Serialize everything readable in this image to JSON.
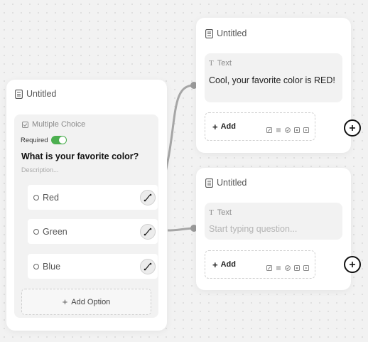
{
  "question_card": {
    "title": "Untitled",
    "block_type": "Multiple Choice",
    "required_label": "Required",
    "question": "What is your favorite color?",
    "description_placeholder": "Description...",
    "options": [
      {
        "label": "Red"
      },
      {
        "label": "Green"
      },
      {
        "label": "Blue"
      }
    ],
    "add_option_label": "Add Option"
  },
  "text_card_1": {
    "title": "Untitled",
    "block_type": "Text",
    "text": "Cool, your favorite color is RED!",
    "add_label": "Add"
  },
  "text_card_2": {
    "title": "Untitled",
    "block_type": "Text",
    "placeholder": "Start typing question...",
    "add_label": "Add"
  },
  "colors": {
    "toggle_on": "#4caf50",
    "connector": "#a6a6a6"
  }
}
